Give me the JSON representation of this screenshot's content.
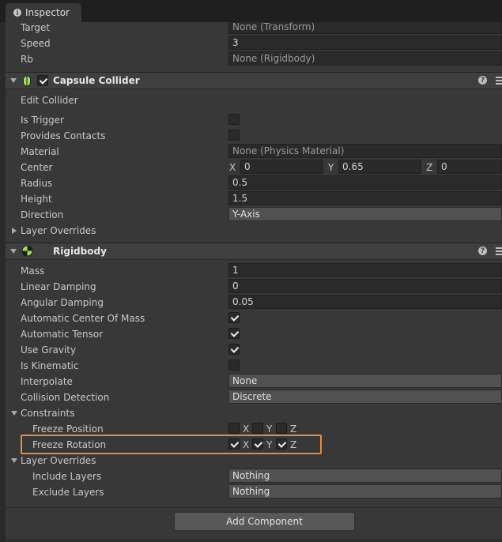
{
  "tab": {
    "title": "Inspector",
    "icon": "info-icon"
  },
  "script_fields": [
    {
      "label": "Target",
      "value": "None (Transform)"
    },
    {
      "label": "Speed",
      "value": "3"
    },
    {
      "label": "Rb",
      "value": "None (Rigidbody)"
    }
  ],
  "capsule_collider": {
    "title": "Capsule Collider",
    "enabled": true,
    "edit_collider": "Edit Collider",
    "is_trigger": {
      "label": "Is Trigger",
      "checked": false
    },
    "provides_contacts": {
      "label": "Provides Contacts",
      "checked": false
    },
    "material": {
      "label": "Material",
      "value": "None (Physics Material)"
    },
    "center": {
      "label": "Center",
      "x_label": "X",
      "x": "0",
      "y_label": "Y",
      "y": "0.65",
      "z_label": "Z",
      "z": "0"
    },
    "radius": {
      "label": "Radius",
      "value": "0.5"
    },
    "height": {
      "label": "Height",
      "value": "1.5"
    },
    "direction": {
      "label": "Direction",
      "value": "Y-Axis"
    },
    "layer_overrides": "Layer Overrides"
  },
  "rigidbody": {
    "title": "Rigidbody",
    "mass": {
      "label": "Mass",
      "value": "1"
    },
    "linear_damping": {
      "label": "Linear Damping",
      "value": "0"
    },
    "angular_damping": {
      "label": "Angular Damping",
      "value": "0.05"
    },
    "auto_center_of_mass": {
      "label": "Automatic Center Of Mass",
      "checked": true
    },
    "auto_tensor": {
      "label": "Automatic Tensor",
      "checked": true
    },
    "use_gravity": {
      "label": "Use Gravity",
      "checked": true
    },
    "is_kinematic": {
      "label": "Is Kinematic",
      "checked": false
    },
    "interpolate": {
      "label": "Interpolate",
      "value": "None"
    },
    "collision_detection": {
      "label": "Collision Detection",
      "value": "Discrete"
    },
    "constraints": {
      "label": "Constraints",
      "freeze_position": {
        "label": "Freeze Position",
        "x": false,
        "y": false,
        "z": false,
        "x_label": "X",
        "y_label": "Y",
        "z_label": "Z"
      },
      "freeze_rotation": {
        "label": "Freeze Rotation",
        "x": true,
        "y": true,
        "z": true,
        "x_label": "X",
        "y_label": "Y",
        "z_label": "Z"
      }
    },
    "layer_overrides": {
      "label": "Layer Overrides",
      "include_layers": {
        "label": "Include Layers",
        "value": "Nothing"
      },
      "exclude_layers": {
        "label": "Exclude Layers",
        "value": "Nothing"
      }
    }
  },
  "add_component": "Add Component",
  "colors": {
    "panel": "#383838",
    "field": "#2a2a2a",
    "highlight": "#ee8a30",
    "collider_icon": "#9fe34f"
  }
}
